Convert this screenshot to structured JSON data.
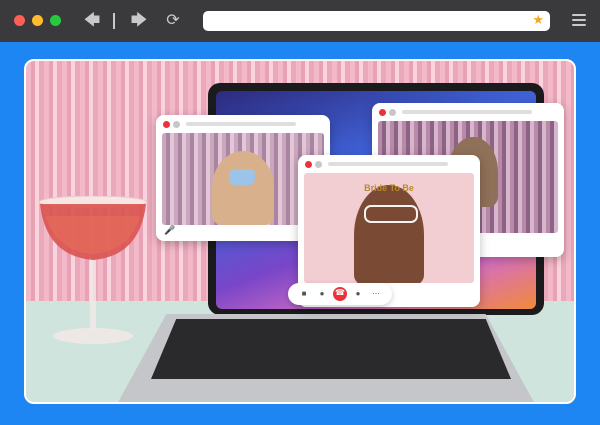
{
  "browser": {
    "url_value": "",
    "icons": [
      "back-arrow-icon",
      "forward-arrow-icon",
      "reload-icon",
      "star-icon",
      "menu-icon"
    ]
  },
  "colors": {
    "page_bg": "#1d86f2",
    "toolbar": "#3a3a3c",
    "traffic_red": "#fe5f57",
    "traffic_yellow": "#febc2e",
    "traffic_green": "#28c840",
    "star": "#f5a623",
    "end_call": "#e9333b"
  },
  "video_call": {
    "controls": [
      "camera-icon",
      "mic-icon",
      "end-call-icon",
      "add-person-icon",
      "more-icon"
    ]
  },
  "sign_text": "Bride To Be"
}
